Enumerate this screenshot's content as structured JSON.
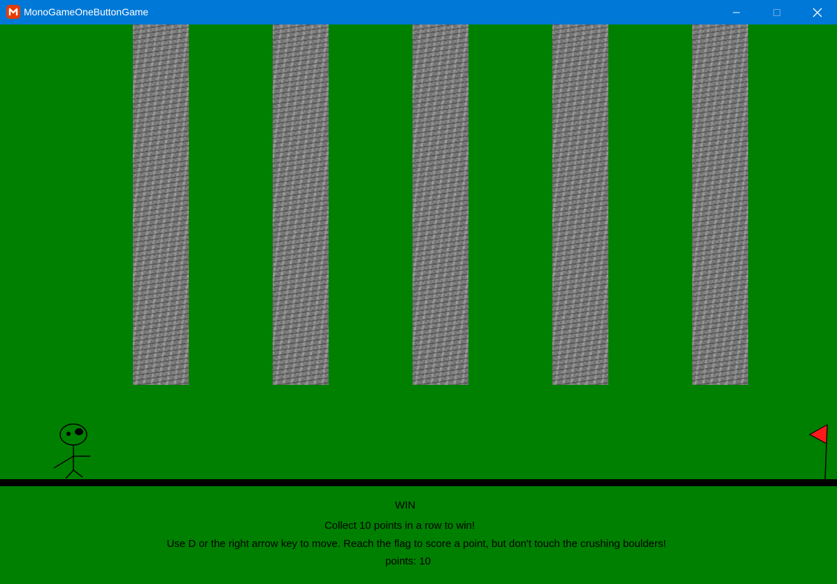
{
  "window": {
    "title": "MonoGameOneButtonGame",
    "app_icon": "monogame-logo-icon",
    "titlebar_color": "#0078d7",
    "controls": {
      "minimize": "minimize-icon",
      "maximize": "maximize-icon",
      "close": "close-icon"
    }
  },
  "game": {
    "background_color": "#008000",
    "ground_color": "#000000",
    "boulders": [
      {
        "name": "boulder-1"
      },
      {
        "name": "boulder-2"
      },
      {
        "name": "boulder-3"
      },
      {
        "name": "boulder-4"
      },
      {
        "name": "boulder-5"
      }
    ],
    "player_icon": "stick-figure",
    "goal_icon": "red-flag",
    "flag_color": "#ff0000"
  },
  "hud": {
    "status": "WIN",
    "goal": "Collect 10 points in a row to win!",
    "instructions": "Use D or the right arrow key to move. Reach the flag to score a point, but don't touch the crushing boulders!",
    "points": "points: 10"
  }
}
